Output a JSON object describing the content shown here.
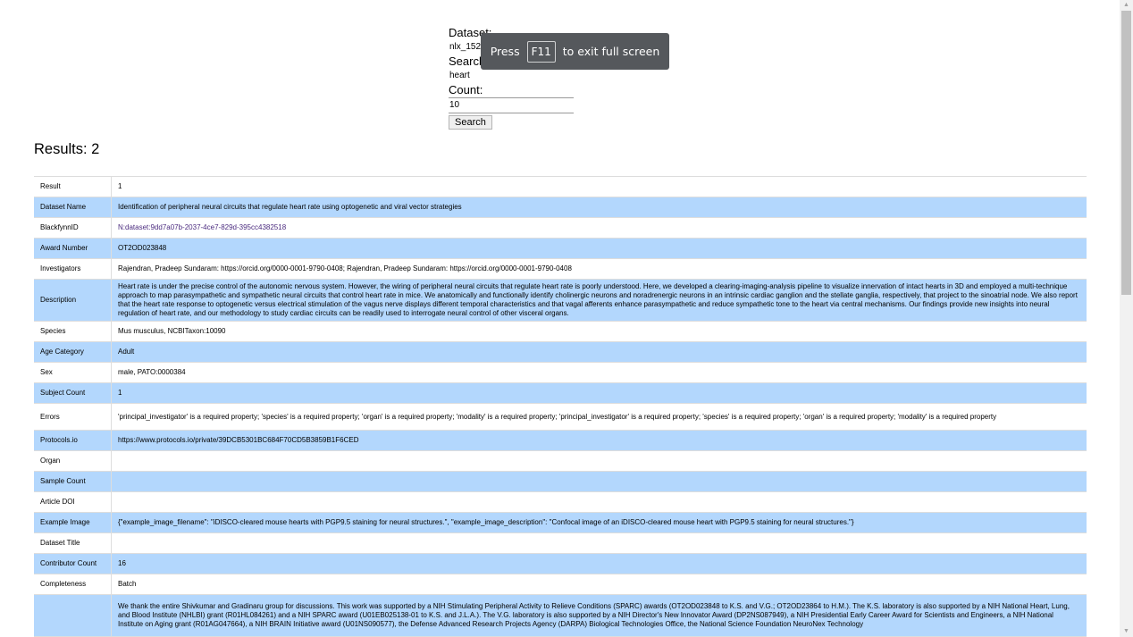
{
  "form": {
    "dataset_label": "Dataset:",
    "dataset_value": "nlx_152175-1",
    "search_label": "Search term:",
    "search_value": "heart",
    "count_label": "Count:",
    "count_value": "10",
    "search_button": "Search"
  },
  "fullscreen_toast": {
    "prefix": "Press",
    "key": "F11",
    "suffix": "to exit full screen"
  },
  "results": {
    "title": "Results: 2",
    "rows": [
      {
        "key": "Result",
        "value": "1"
      },
      {
        "key": "Dataset Name",
        "value": "Identification of peripheral neural circuits that regulate heart rate using optogenetic and viral vector strategies"
      },
      {
        "key": "BlackfynnID",
        "value": "N:dataset:9dd7a07b-2037-4ce7-829d-395cc4382518"
      },
      {
        "key": "Award Number",
        "value": "OT2OD023848"
      },
      {
        "key": "Investigators",
        "value": "Rajendran, Pradeep Sundaram: https://orcid.org/0000-0001-9790-0408; Rajendran, Pradeep Sundaram: https://orcid.org/0000-0001-9790-0408"
      },
      {
        "key": "Description",
        "value": "Heart rate is under the precise control of the autonomic nervous system. However, the wiring of peripheral neural circuits that regulate heart rate is poorly understood. Here, we developed a clearing-imaging-analysis pipeline to visualize innervation of intact hearts in 3D and employed a multi-technique approach to map parasympathetic and sympathetic neural circuits that control heart rate in mice. We anatomically and functionally identify cholinergic neurons and noradrenergic neurons in an intrinsic cardiac ganglion and the stellate ganglia, respectively, that project to the sinoatrial node. We also report that the heart rate response to optogenetic versus electrical stimulation of the vagus nerve displays different temporal characteristics and that vagal afferents enhance parasympathetic and reduce sympathetic tone to the heart via central mechanisms. Our findings provide new insights into neural regulation of heart rate, and our methodology to study cardiac circuits can be readily used to interrogate neural control of other visceral organs."
      },
      {
        "key": "Species",
        "value": "Mus musculus, NCBITaxon:10090"
      },
      {
        "key": "Age Category",
        "value": "Adult"
      },
      {
        "key": "Sex",
        "value": "male, PATO:0000384"
      },
      {
        "key": "Subject Count",
        "value": "1"
      },
      {
        "key": "Errors",
        "value": "'principal_investigator' is a required property; 'species' is a required property; 'organ' is a required property; 'modality' is a required property; 'principal_investigator' is a required property; 'species' is a required property; 'organ' is a required property; 'modality' is a required property"
      },
      {
        "key": "Protocols.io",
        "value": "https://www.protocols.io/private/39DCB5301BC684F70CD5B3859B1F6CED"
      },
      {
        "key": "Organ",
        "value": ""
      },
      {
        "key": "Sample Count",
        "value": ""
      },
      {
        "key": "Article DOI",
        "value": ""
      },
      {
        "key": "Example Image",
        "value": "{\"example_image_filename\": \"iDISCO-cleared mouse hearts with PGP9.5 staining for neural structures.\", \"example_image_description\": \"Confocal image of an iDISCO-cleared mouse heart with PGP9.5 staining for neural structures.\"}"
      },
      {
        "key": "Dataset Title",
        "value": ""
      },
      {
        "key": "Contributor Count",
        "value": "16"
      },
      {
        "key": "Completeness",
        "value": "Batch"
      },
      {
        "key": "",
        "value": "We thank the entire Shivkumar and Gradinaru group for discussions. This work was supported by a NIH Stimulating Peripheral Activity to Relieve Conditions (SPARC) awards (OT2OD023848 to K.S. and V.G.; OT2OD23864 to H.M.). The K.S. laboratory is also supported by a NIH National Heart, Lung, and Blood Institute (NHLBI) grant (R01HL084261) and a NIH SPARC award (U01EB025138-01 to K.S. and J.L.A.). The V.G. laboratory is also supported by a NIH Director's New Innovator Award (DP2NS087949), a NIH Presidential Early Career Award for Scientists and Engineers, a NIH National Institute on Aging grant (R01AG047664), a NIH BRAIN Initiative award (U01NS090577), the Defense Advanced Research Projects Agency (DARPA) Biological Technologies Office, the National Science Foundation NeuroNex Technology"
      }
    ]
  }
}
